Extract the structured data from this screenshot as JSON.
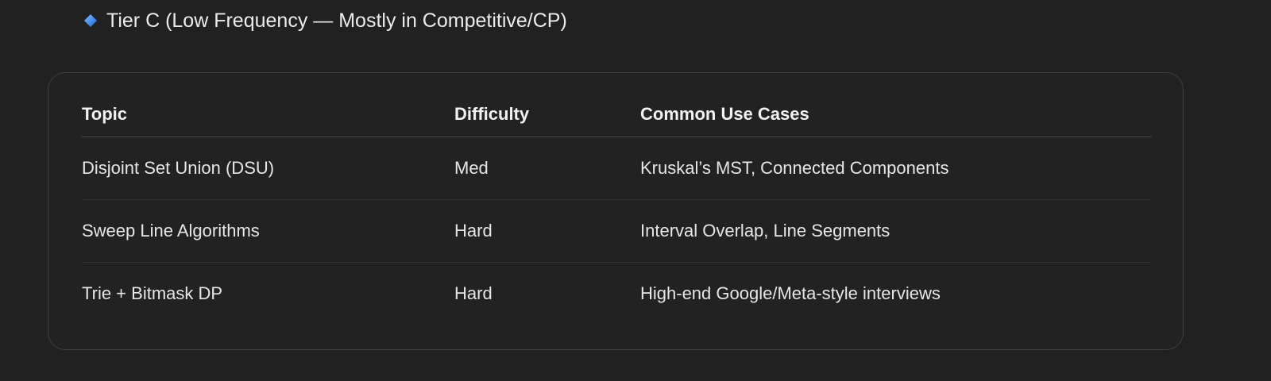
{
  "heading": {
    "icon": "blue-diamond-icon",
    "text": "Tier C (Low Frequency — Mostly in Competitive/CP)"
  },
  "table": {
    "headers": [
      "Topic",
      "Difficulty",
      "Common Use Cases"
    ],
    "rows": [
      [
        "Disjoint Set Union (DSU)",
        "Med",
        "Kruskal’s MST, Connected Components"
      ],
      [
        "Sweep Line Algorithms",
        "Hard",
        "Interval Overlap, Line Segments"
      ],
      [
        "Trie + Bitmask DP",
        "Hard",
        "High-end Google/Meta-style interviews"
      ]
    ]
  },
  "colors": {
    "background": "#212121",
    "border": "#3e3e3e",
    "text": "#ececec",
    "diamond": "#4a90e2"
  }
}
